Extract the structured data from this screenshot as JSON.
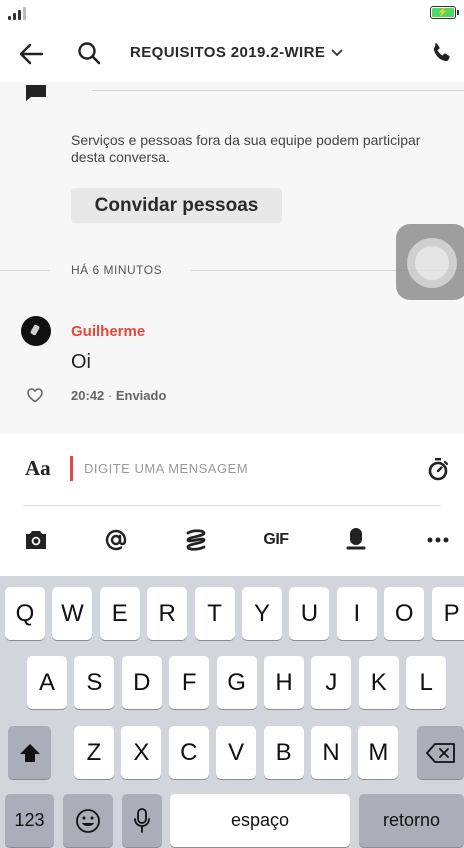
{
  "nav": {
    "title": "REQUISITOS 2019.2-WIRE",
    "icons": [
      "back-arrow-icon",
      "search-icon",
      "chevron-down-icon",
      "phone-icon"
    ]
  },
  "conversation": {
    "notice": "Serviços e pessoas fora da sua equipe podem participar desta conversa.",
    "invite_label": "Convidar pessoas",
    "time_divider": "HÁ 6 MINUTOS",
    "message": {
      "author": "Guilherme",
      "text": "Oi",
      "time": "20:42",
      "separator": "·",
      "status": "Enviado"
    }
  },
  "input": {
    "format_label": "Aa",
    "placeholder": "DIGITE UMA MENSAGEM",
    "gif_label": "GIF",
    "tools": [
      "camera-icon",
      "mention-icon",
      "sketch-icon",
      "gif-button",
      "microphone-icon",
      "more-icon"
    ]
  },
  "keyboard": {
    "row1": [
      "Q",
      "W",
      "E",
      "R",
      "T",
      "Y",
      "U",
      "I",
      "O",
      "P"
    ],
    "row2": [
      "A",
      "S",
      "D",
      "F",
      "G",
      "H",
      "J",
      "K",
      "L"
    ],
    "row3": [
      "Z",
      "X",
      "C",
      "V",
      "B",
      "N",
      "M"
    ],
    "numbers_label": "123",
    "space_label": "espaço",
    "return_label": "retorno"
  },
  "colors": {
    "accent": "#e6493b",
    "keyboard_bg": "#d2d5db",
    "battery": "#4cd964"
  }
}
